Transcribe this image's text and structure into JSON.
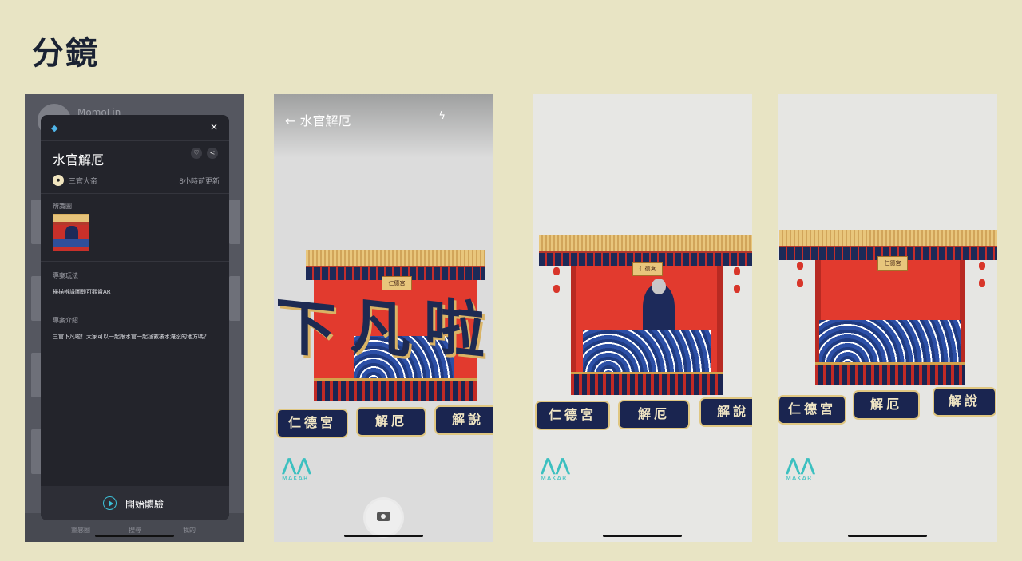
{
  "page": {
    "title": "分鏡"
  },
  "phone1": {
    "bg_name": "MomoLin",
    "bg_nav": [
      "靈感圈",
      "搜尋",
      "我的"
    ],
    "modal": {
      "close": "×",
      "title": "水官解厄",
      "creator": "三官大帝",
      "updated": "8小時前更新",
      "marker_label": "辨識圖",
      "gameplay_label": "專案玩法",
      "gameplay_text": "掃描辨識圖即可觀賞AR",
      "intro_label": "專案介紹",
      "intro_text": "三官下凡啦！大家可以一起跟水官一起拯救被水淹沒的地方嗎？",
      "start_label": "開始體驗"
    }
  },
  "phone2": {
    "back_title": "← 水官解厄",
    "flash_icon": "flash-off-icon",
    "big_text": [
      "下",
      "凡",
      "啦"
    ],
    "plaque": "仁德宮",
    "tiles": [
      "仁德宮",
      "解厄",
      "解說"
    ],
    "makar_brand": "MAKAR"
  },
  "phone3": {
    "plaque": "仁德宮",
    "tiles": [
      "仁德宮",
      "解厄",
      "解說"
    ],
    "makar_brand": "MAKAR"
  },
  "phone4": {
    "plaque": "仁德宮",
    "tiles": [
      "仁德宮",
      "解厄",
      "解說"
    ],
    "makar_brand": "MAKAR"
  },
  "colors": {
    "background": "#e8e4c4",
    "accent": "#3cc0d8",
    "shrine_red": "#e23a2e",
    "navy": "#1a2550"
  }
}
